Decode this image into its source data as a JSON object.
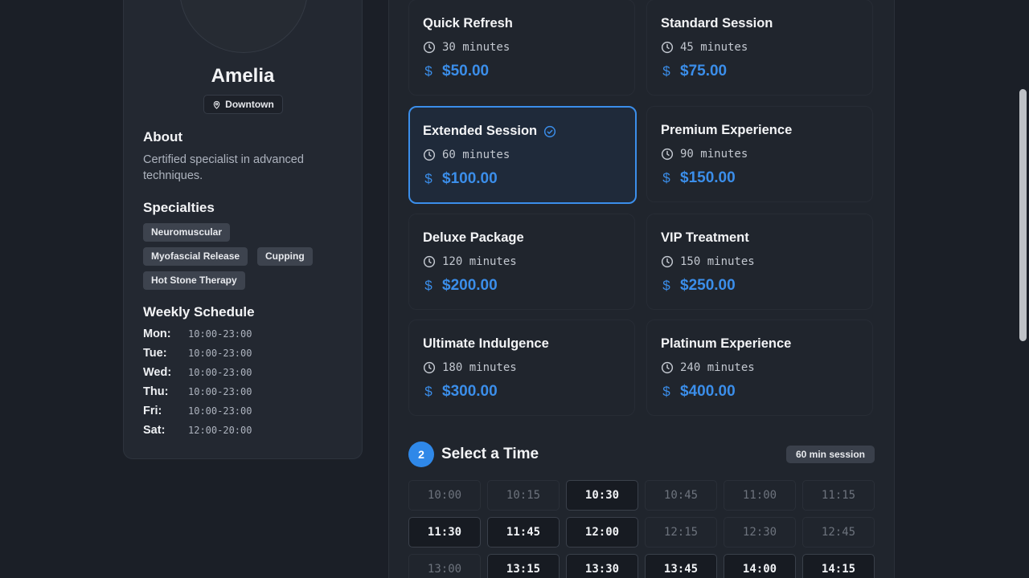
{
  "profile": {
    "name": "Amelia",
    "location": "Downtown",
    "about_title": "About",
    "about_text": "Certified specialist in advanced techniques.",
    "specialties_title": "Specialties",
    "specialties": [
      "Neuromuscular",
      "Myofascial Release",
      "Cupping",
      "Hot Stone Therapy"
    ],
    "schedule_title": "Weekly Schedule",
    "schedule": [
      {
        "day": "Mon:",
        "hours": "10:00-23:00"
      },
      {
        "day": "Tue:",
        "hours": "10:00-23:00"
      },
      {
        "day": "Wed:",
        "hours": "10:00-23:00"
      },
      {
        "day": "Thu:",
        "hours": "10:00-23:00"
      },
      {
        "day": "Fri:",
        "hours": "10:00-23:00"
      },
      {
        "day": "Sat:",
        "hours": "12:00-20:00"
      }
    ]
  },
  "services": [
    {
      "name": "Quick Refresh",
      "duration": "30 minutes",
      "price": "$50.00",
      "selected": false
    },
    {
      "name": "Standard Session",
      "duration": "45 minutes",
      "price": "$75.00",
      "selected": false
    },
    {
      "name": "Extended Session",
      "duration": "60 minutes",
      "price": "$100.00",
      "selected": true
    },
    {
      "name": "Premium Experience",
      "duration": "90 minutes",
      "price": "$150.00",
      "selected": false
    },
    {
      "name": "Deluxe Package",
      "duration": "120 minutes",
      "price": "$200.00",
      "selected": false
    },
    {
      "name": "VIP Treatment",
      "duration": "150 minutes",
      "price": "$250.00",
      "selected": false
    },
    {
      "name": "Ultimate Indulgence",
      "duration": "180 minutes",
      "price": "$300.00",
      "selected": false
    },
    {
      "name": "Platinum Experience",
      "duration": "240 minutes",
      "price": "$400.00",
      "selected": false
    }
  ],
  "time_section": {
    "step": "2",
    "title": "Select a Time",
    "session_badge": "60 min session",
    "slots": [
      {
        "time": "10:00",
        "available": false
      },
      {
        "time": "10:15",
        "available": false
      },
      {
        "time": "10:30",
        "available": true
      },
      {
        "time": "10:45",
        "available": false
      },
      {
        "time": "11:00",
        "available": false
      },
      {
        "time": "11:15",
        "available": false
      },
      {
        "time": "11:30",
        "available": true
      },
      {
        "time": "11:45",
        "available": true
      },
      {
        "time": "12:00",
        "available": true
      },
      {
        "time": "12:15",
        "available": false
      },
      {
        "time": "12:30",
        "available": false
      },
      {
        "time": "12:45",
        "available": false
      },
      {
        "time": "13:00",
        "available": false
      },
      {
        "time": "13:15",
        "available": true
      },
      {
        "time": "13:30",
        "available": true
      },
      {
        "time": "13:45",
        "available": true
      },
      {
        "time": "14:00",
        "available": true
      },
      {
        "time": "14:15",
        "available": true
      }
    ]
  },
  "colors": {
    "accent": "#3b8eea",
    "background": "#1b1f27",
    "card": "#232831"
  }
}
